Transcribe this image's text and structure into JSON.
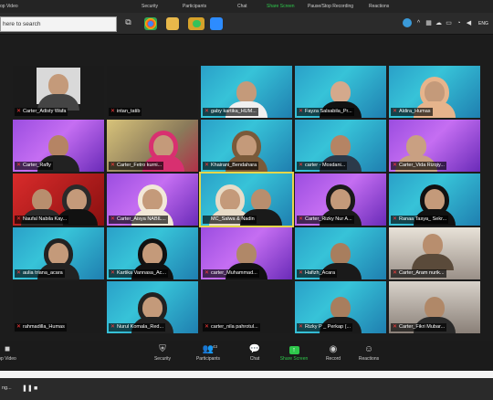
{
  "top_toolbar": {
    "items": [
      "op Video",
      "Security",
      "Participants",
      "Chat",
      "Share Screen",
      "Pause/Stop Recording",
      "Reactions"
    ]
  },
  "taskbar": {
    "search_placeholder": "here to search",
    "language": "ENG"
  },
  "tiles": [
    {
      "name": "Carter_Adisty Wafa",
      "muted": true
    },
    {
      "name": "intan_tatib",
      "muted": true
    },
    {
      "name": "gaby kartika_HUM...",
      "muted": true
    },
    {
      "name": "Fayza Salsabila_Pr...",
      "muted": true
    },
    {
      "name": "Aldira_Humas",
      "muted": true
    },
    {
      "name": "Carter_Rafly",
      "muted": true
    },
    {
      "name": "Carter_Fetro kurni...",
      "muted": true
    },
    {
      "name": "Khairani_Bendahara",
      "muted": true
    },
    {
      "name": "carter - Mosdani...",
      "muted": true
    },
    {
      "name": "Carter_Vida Rizqiy...",
      "muted": true
    },
    {
      "name": "Naufal Nabila Kay...",
      "muted": true
    },
    {
      "name": "Carter_Aisya NABIL...",
      "muted": true
    },
    {
      "name": "MC_Salwa & Nadin",
      "muted": false
    },
    {
      "name": "Carter_Rizky Nur A...",
      "muted": true
    },
    {
      "name": "Ranaa Tasya_ Sekr...",
      "muted": true
    },
    {
      "name": "aulia triana_acara",
      "muted": true
    },
    {
      "name": "Kartika Vannasa_Ac...",
      "muted": true
    },
    {
      "name": "carter_Muhammad...",
      "muted": true
    },
    {
      "name": "Hafizh_Acara",
      "muted": true
    },
    {
      "name": "Carter_Aram nurik...",
      "muted": true
    },
    {
      "name": "rahmadilla_Humas",
      "muted": true
    },
    {
      "name": "Nurul Komala_Red...",
      "muted": true
    },
    {
      "name": "carter_nila pahrotul...",
      "muted": true
    },
    {
      "name": "Rizky P _ Perkap (...",
      "muted": true
    },
    {
      "name": "Carter_Fikri Mubar...",
      "muted": true
    }
  ],
  "controls": {
    "stop_video": "op Video",
    "security": "Security",
    "participants": "Participants",
    "participants_count": "43",
    "chat": "Chat",
    "share_screen": "Share Screen",
    "record": "Record",
    "reactions": "Reactions"
  },
  "status_bar": {
    "text": "ng..."
  },
  "colors": {
    "accent_green": "#2ec74b",
    "active_speaker": "#e6d64a",
    "muted_red": "#ff3b3b"
  }
}
